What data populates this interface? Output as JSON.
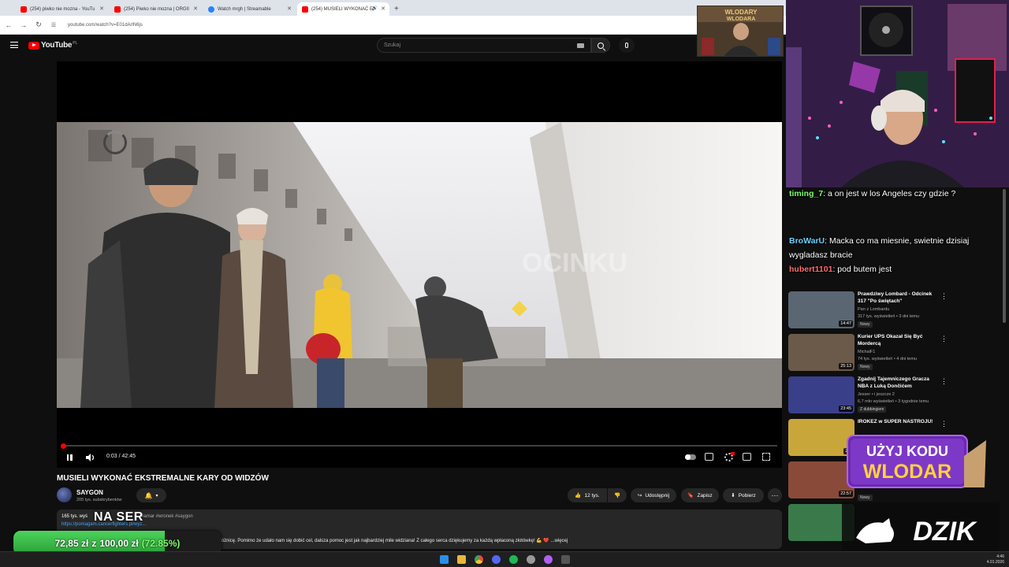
{
  "browser": {
    "tabs": [
      {
        "title": "(254) piwko nie mozna - YouTu",
        "favicon_color": "#ff0000",
        "active": false
      },
      {
        "title": "(254) Piwko nie mozna | ORGII",
        "favicon_color": "#ff0000",
        "active": false
      },
      {
        "title": "Watch mrgh | Streamable",
        "favicon_color": "#2a83f6",
        "active": false
      },
      {
        "title": "(254) MUSIELI WYKONAĆ E",
        "favicon_color": "#ff0000",
        "active": true
      }
    ],
    "new_tab": "+",
    "url": "youtube.com/watch?v=E01dArlN6js"
  },
  "youtube": {
    "logo_text": "YouTube",
    "logo_country": "PL",
    "search_placeholder": "Szukaj"
  },
  "player": {
    "time": "0:03 / 42:45",
    "progress_fraction": 0.0012,
    "overlay_text": "OCINKU"
  },
  "video": {
    "title": "MUSIELI WYKONAĆ EKSTREMALNE KARY OD WIDZÓW",
    "channel": "SAYGON",
    "subscribers": "205 tys. subskrybentów",
    "likes": "12 tys.",
    "share": "Udostępnij",
    "save": "Zapisz",
    "download": "Pobierz",
    "more": "⋯",
    "desc_meta": "165 tys. wyś",
    "desc_hashtags": "#amar #wronek #saygon",
    "desc_link": "https://pomagam.cancerfighters.pl/wyz...",
    "desc_text": "nd w tym szczytnym celu, każda złotówka oraz udostępnienie potrafi zrobić różnicę. Pomimo że udało nam się dobić cel, dalsza pomoc jest jak najbardziej mile widziana! Z całego serca dziękujemy za każdą wpłaconą złotówkę! 💪 ❤️ ...więcej"
  },
  "overlays": {
    "naser": "NA SER",
    "donation_current": "72,85 zł",
    "donation_sep": "z",
    "donation_goal": "100,00 zł",
    "donation_percent": "(72.85%)",
    "donation_fraction": 0.7285,
    "wlodary_banner": "WLODARY WLODARA",
    "code_line1": "UŻYJ KODU",
    "code_line2": "WLODAR",
    "dzik_logo": "DZIK"
  },
  "chat": [
    {
      "user": "timing_7",
      "user_color": "#7cff6b",
      "text": "a on jest w los Angeles czy gdzie ?"
    },
    {
      "user": "hubert1101",
      "user_color": "#ff6b6b",
      "text": "pod butem jest"
    },
    {
      "user": "BroWarU",
      "user_color": "#6bd0ff",
      "text": "Macka co ma miesnie, swietnie dzisiaj"
    },
    {
      "user": "",
      "user_color": "#ffffff",
      "text": "wygladasz bracie"
    }
  ],
  "recommended": [
    {
      "title": "Prawdziwy Lombard - Odcinek 317 \"Po świętach\"",
      "channel": "Pan z Lombardu",
      "meta": "317 tys. wyświetleń • 3 dni temu",
      "badge": "Nowy",
      "duration": "14:47",
      "color": "#5a6672"
    },
    {
      "title": "Kurier UPS Okazał Się Być Mordercą",
      "channel": "MichalF1",
      "meta": "74 tys. wyświetleń • 4 dni temu",
      "badge": "Nowy",
      "duration": "25:13",
      "color": "#6b5a4a"
    },
    {
      "title": "Zgadnij Tajemniczego Gracza NBA z Luką Dončićem",
      "channel": "Jesser • i jeszcze 2",
      "meta": "6,7 mln wyświetleń • 3 tygodnie temu",
      "badge": "Z dubbingiem",
      "duration": "23:45",
      "color": "#3a3f8a"
    },
    {
      "title": "IROKEZ w SUPER NASTROJU!",
      "channel": "",
      "meta": "",
      "badge": "",
      "duration": "27:",
      "color": "#c9a63a"
    },
    {
      "title": "",
      "channel": "",
      "meta": "",
      "badge": "Nowy",
      "duration": "22:57",
      "color": "#8a4a3a"
    },
    {
      "title": "",
      "channel": "",
      "meta": "",
      "badge": "",
      "duration": "",
      "color": "#3a7a4a"
    }
  ],
  "taskbar": {
    "time": "4:46",
    "date": "4.01.2026"
  }
}
